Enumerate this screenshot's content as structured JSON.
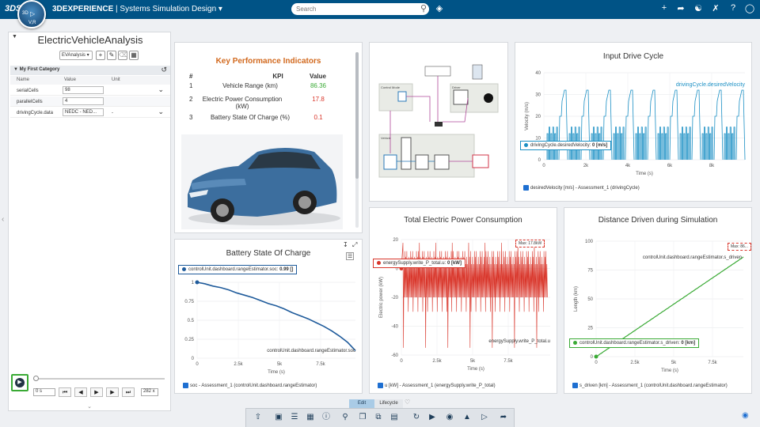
{
  "topbar": {
    "brand": "3DS",
    "compass_label": "V,R",
    "compass_num": "3D",
    "app_prefix": "3DEXPERIENCE",
    "app_separator": "|",
    "app_name": "Systems Simulation Design",
    "search_placeholder": "Search",
    "icons": [
      "plus-icon",
      "share-icon",
      "network-icon",
      "tools-icon",
      "help-icon",
      "user-icon"
    ]
  },
  "left_panel": {
    "title": "ElectricVehicleAnalysis",
    "selector_value": "EVAnalysis",
    "category": "My First Category",
    "columns": [
      "Name",
      "Value",
      "Unit"
    ],
    "params": [
      {
        "name": "serialCells",
        "value": "98",
        "unit": ""
      },
      {
        "name": "parallelCells",
        "value": "4",
        "unit": ""
      },
      {
        "name": "drivingCycle.data",
        "value": "NEDC - NED...",
        "unit": "-"
      }
    ],
    "time_value": "0 s",
    "speed_value": "282 x"
  },
  "kpi": {
    "title": "Key Performance Indicators",
    "headers": [
      "#",
      "KPI",
      "Value"
    ],
    "rows": [
      {
        "n": "1",
        "kpi": "Vehicle Range (km)",
        "value": "86.36",
        "color": "#3aaa35"
      },
      {
        "n": "2",
        "kpi": "Electric Power Consumption (kW)",
        "value": "17.8",
        "color": "#d9362b"
      },
      {
        "n": "3",
        "kpi": "Battery State Of Charge (%)",
        "value": "0.1",
        "color": "#d9362b"
      }
    ]
  },
  "diagram": {
    "blocks": [
      "Control Mode",
      "Driver",
      "Vehicle"
    ]
  },
  "drive_cycle": {
    "title": "Input Drive Cycle",
    "series_label": "drivingCycle.desiredVelocity",
    "tooltip": "drivingCycle.desiredVelocity:",
    "tooltip_value": "0 [m/s]",
    "legend": "desiredVelocity [m/s] - Assessment_1 (drivingCycle)",
    "ylabel": "Velocity (m/s)",
    "xlabel": "Time (s)",
    "yticks": [
      "0",
      "10",
      "20",
      "30",
      "40"
    ],
    "xticks": [
      "0",
      "2k",
      "4k",
      "6k",
      "8k"
    ]
  },
  "soc": {
    "title": "Battery State Of Charge",
    "tooltip": "controlUnit.dashboard.rangeEstimator.soc:",
    "tooltip_value": "0.99 []",
    "series_label": "controlUnit.dashboard.rangeEstimator.soc",
    "legend": "soc - Assessment_1 (controlUnit.dashboard.rangeEstimator)",
    "xlabel": "Time (s)",
    "yticks": [
      "0",
      "0.25",
      "0.5",
      "0.75",
      "1"
    ],
    "xticks": [
      "0",
      "2.5k",
      "5k",
      "7.5k"
    ]
  },
  "power": {
    "title": "Total Electric Power Consumption",
    "tooltip": "energySupply.write_P_total.u:",
    "tooltip_value": "0 [kW]",
    "max_label": "Max: 17.8kW",
    "series_label": "energySupply.write_P_total.u",
    "legend": "u [kW] - Assessment_1 (energySupply.write_P_total)",
    "ylabel": "Electric power (kW)",
    "xlabel": "Time (s)",
    "yticks": [
      "-60",
      "-40",
      "-20",
      "0",
      "20"
    ],
    "xticks": [
      "0",
      "2.5k",
      "5k",
      "7.5k"
    ]
  },
  "distance": {
    "title": "Distance Driven during Simulation",
    "max_label": "Max: 86...",
    "series_label": "controlUnit.dashboard.rangeEstimator.s_driven",
    "tooltip": "controlUnit.dashboard.rangeEstimator.s_driven:",
    "tooltip_value": "0 [km]",
    "legend": "s_driven [km] - Assessment_1 (controlUnit.dashboard.rangeEstimator)",
    "ylabel": "Length (km)",
    "xlabel": "Time (s)",
    "yticks": [
      "0",
      "25",
      "50",
      "75",
      "100"
    ],
    "xticks": [
      "0",
      "2.5k",
      "5k",
      "7.5k"
    ]
  },
  "bottom": {
    "tabs": [
      "Edit",
      "Lifecycle"
    ],
    "icons": [
      "export-icon",
      "save-icon",
      "list-icon",
      "table-icon",
      "info-icon",
      "search-icon",
      "copy-icon",
      "layers-icon",
      "loop-icon",
      "play-icon",
      "record-icon",
      "calendar-icon",
      "chart-icon",
      "run-icon",
      "export-file-icon"
    ]
  },
  "colors": {
    "topbar": "#005386",
    "blue": "#1a8fc4",
    "red": "#d9362b",
    "green": "#3aaa35",
    "soc": "#1f5b9b",
    "kpi_title": "#d2691e"
  }
}
